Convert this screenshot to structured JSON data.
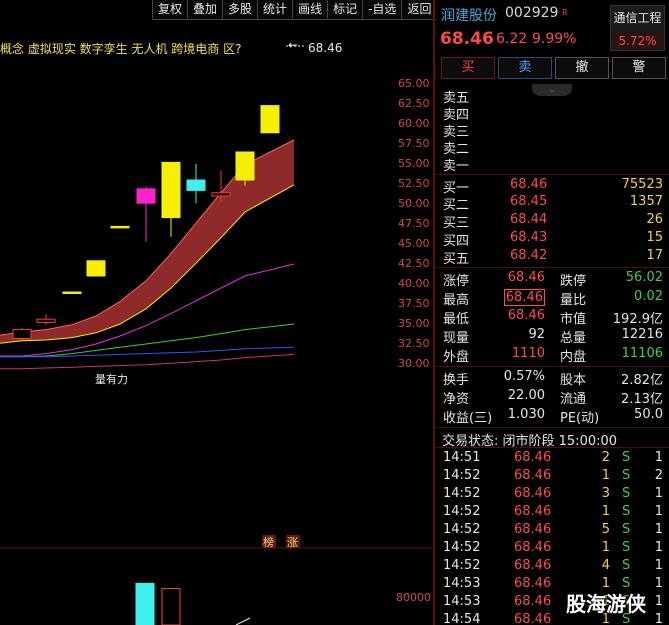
{
  "toolbar": [
    "复权",
    "叠加",
    "多股",
    "统计",
    "画线",
    "标记",
    "-自选",
    "返回"
  ],
  "concept_line": "概念 虚拟现实 数字孪生 无人机 跨境电商 区?",
  "price_callout": "68.46",
  "callout_arrow": "←",
  "annotation_text": "量有力",
  "price_axis": [
    "65.00",
    "62.50",
    "60.00",
    "57.50",
    "55.00",
    "52.50",
    "50.00",
    "47.50",
    "45.00",
    "42.50",
    "40.00",
    "37.50",
    "35.00",
    "32.50",
    "30.00"
  ],
  "volume_axis": [
    "80000"
  ],
  "bottom_tags": [
    "榜",
    "涨"
  ],
  "chart_data": {
    "type": "candlestick",
    "candles": [
      {
        "open": 33.2,
        "close": 34.3,
        "high": 34.5,
        "low": 33.0,
        "color": "#ff3a3a"
      },
      {
        "open": 35.2,
        "close": 35.6,
        "high": 36.2,
        "low": 34.9,
        "color": "#ff3a3a"
      },
      {
        "open": 39.0,
        "close": 39.0,
        "high": 39.0,
        "low": 39.0,
        "color": "#f5f000"
      },
      {
        "open": 41.0,
        "close": 42.9,
        "high": 42.9,
        "low": 41.0,
        "color": "#f5f000"
      },
      {
        "open": 47.2,
        "close": 47.2,
        "high": 47.2,
        "low": 47.2,
        "color": "#f5f000"
      },
      {
        "open": 50.1,
        "close": 51.9,
        "high": 52.2,
        "low": 45.3,
        "color": "#ff22cc"
      },
      {
        "open": 48.3,
        "close": 55.2,
        "high": 55.2,
        "low": 45.9,
        "color": "#f5f000"
      },
      {
        "open": 51.7,
        "close": 53.0,
        "high": 55.0,
        "low": 50.1,
        "color": "#40f0f0"
      },
      {
        "open": 51.0,
        "close": 51.4,
        "high": 54.2,
        "low": 50.3,
        "color": "#ff3a3a"
      },
      {
        "open": 53.0,
        "close": 56.5,
        "high": 56.5,
        "low": 52.3,
        "color": "#f5f000"
      },
      {
        "open": 58.9,
        "close": 62.3,
        "high": 62.3,
        "low": 58.9,
        "color": "#f5f000"
      }
    ],
    "band_upper": [
      34.0,
      34.3,
      34.9,
      36.0,
      37.8,
      40.4,
      43.8,
      47.6,
      51.4,
      54.9,
      58.0
    ],
    "band_lower": [
      32.9,
      33.0,
      33.3,
      33.9,
      35.0,
      36.9,
      39.5,
      42.6,
      45.8,
      49.0,
      52.4
    ],
    "ma_magenta": [
      31.0,
      31.3,
      31.8,
      32.5,
      33.5,
      34.8,
      36.3,
      37.9,
      39.5,
      41.0,
      42.5
    ],
    "ma_green": [
      30.9,
      31.0,
      31.3,
      31.7,
      32.1,
      32.5,
      32.9,
      33.3,
      33.8,
      34.3,
      35.0
    ],
    "ma_blue": [
      30.9,
      30.9,
      31.0,
      31.1,
      31.2,
      31.3,
      31.4,
      31.5,
      31.7,
      31.9,
      32.1
    ],
    "ma_pink": [
      29.4,
      29.5,
      29.6,
      29.7,
      29.8,
      29.9,
      30.1,
      30.3,
      30.5,
      30.8,
      31.2
    ],
    "volume": [
      {
        "value": 72000,
        "color": "#40f0f0"
      },
      {
        "value": 66000,
        "color": "#ff3a3a"
      },
      {
        "value": 22000,
        "color": "#40f0f0"
      }
    ],
    "ylim": [
      28.0,
      66.5
    ]
  },
  "panel": {
    "stock_name": "润建股份",
    "stock_code": "002929",
    "r_badge": "R",
    "industry_name": "通信工程",
    "industry_pct": "5.72%",
    "last_price": "68.46",
    "change_abs": "6.22",
    "change_pct": "9.99%",
    "collapse_icon": "⌄",
    "buttons": {
      "buy": "买",
      "sell": "卖",
      "cancel": "撤",
      "alert": "警"
    },
    "ask": [
      {
        "label": "卖五"
      },
      {
        "label": "卖四"
      },
      {
        "label": "卖三"
      },
      {
        "label": "卖二"
      },
      {
        "label": "卖一"
      }
    ],
    "bid": [
      {
        "label": "买一",
        "price": "68.46",
        "vol": "75523"
      },
      {
        "label": "买二",
        "price": "68.45",
        "vol": "1357"
      },
      {
        "label": "买三",
        "price": "68.44",
        "vol": "26"
      },
      {
        "label": "买四",
        "price": "68.43",
        "vol": "15"
      },
      {
        "label": "买五",
        "price": "68.42",
        "vol": "17"
      }
    ],
    "quote": [
      {
        "l1": "涨停",
        "v1": "68.46",
        "c1": "red",
        "l2": "跌停",
        "v2": "56.02",
        "c2": "green"
      },
      {
        "l1": "最高",
        "v1": "68.46",
        "c1": "red",
        "l2": "量比",
        "v2": "0.02",
        "c2": "green"
      },
      {
        "l1": "最低",
        "v1": "68.46",
        "c1": "red",
        "l2": "市值",
        "v2": "192.9亿",
        "c2": "white"
      },
      {
        "l1": "现量",
        "v1": "92",
        "c1": "white",
        "l2": "总量",
        "v2": "12216",
        "c2": "white"
      },
      {
        "l1": "外盘",
        "v1": "1110",
        "c1": "red",
        "l2": "内盘",
        "v2": "11106",
        "c2": "green"
      }
    ],
    "stats": [
      {
        "l1": "换手",
        "v1": "0.57%",
        "l2": "股本",
        "v2": "2.82亿"
      },
      {
        "l1": "净资",
        "v1": "22.00",
        "l2": "流通",
        "v2": "2.13亿"
      },
      {
        "l1": "收益(三)",
        "v1": "1.030",
        "l2": "PE(动)",
        "v2": "50.0"
      }
    ],
    "status": "交易状态: 闭市阶段 15:00:00",
    "ticks": [
      {
        "time": "14:51",
        "price": "68.46",
        "vol": "2",
        "side": "S",
        "count": "1"
      },
      {
        "time": "14:52",
        "price": "68.46",
        "vol": "1",
        "side": "S",
        "count": "2"
      },
      {
        "time": "14:52",
        "price": "68.46",
        "vol": "3",
        "side": "S",
        "count": "1"
      },
      {
        "time": "14:52",
        "price": "68.46",
        "vol": "1",
        "side": "S",
        "count": "1"
      },
      {
        "time": "14:52",
        "price": "68.46",
        "vol": "5",
        "side": "S",
        "count": "1"
      },
      {
        "time": "14:52",
        "price": "68.46",
        "vol": "1",
        "side": "S",
        "count": "1"
      },
      {
        "time": "14:52",
        "price": "68.46",
        "vol": "4",
        "side": "S",
        "count": "1"
      },
      {
        "time": "14:53",
        "price": "68.46",
        "vol": "1",
        "side": "S",
        "count": "1"
      },
      {
        "time": "14:53",
        "price": "68.46",
        "vol": "1",
        "side": "S",
        "count": "1"
      },
      {
        "time": "14:54",
        "price": "68.46",
        "vol": "1",
        "side": "S",
        "count": "1"
      }
    ]
  },
  "watermark": "股海游侠"
}
